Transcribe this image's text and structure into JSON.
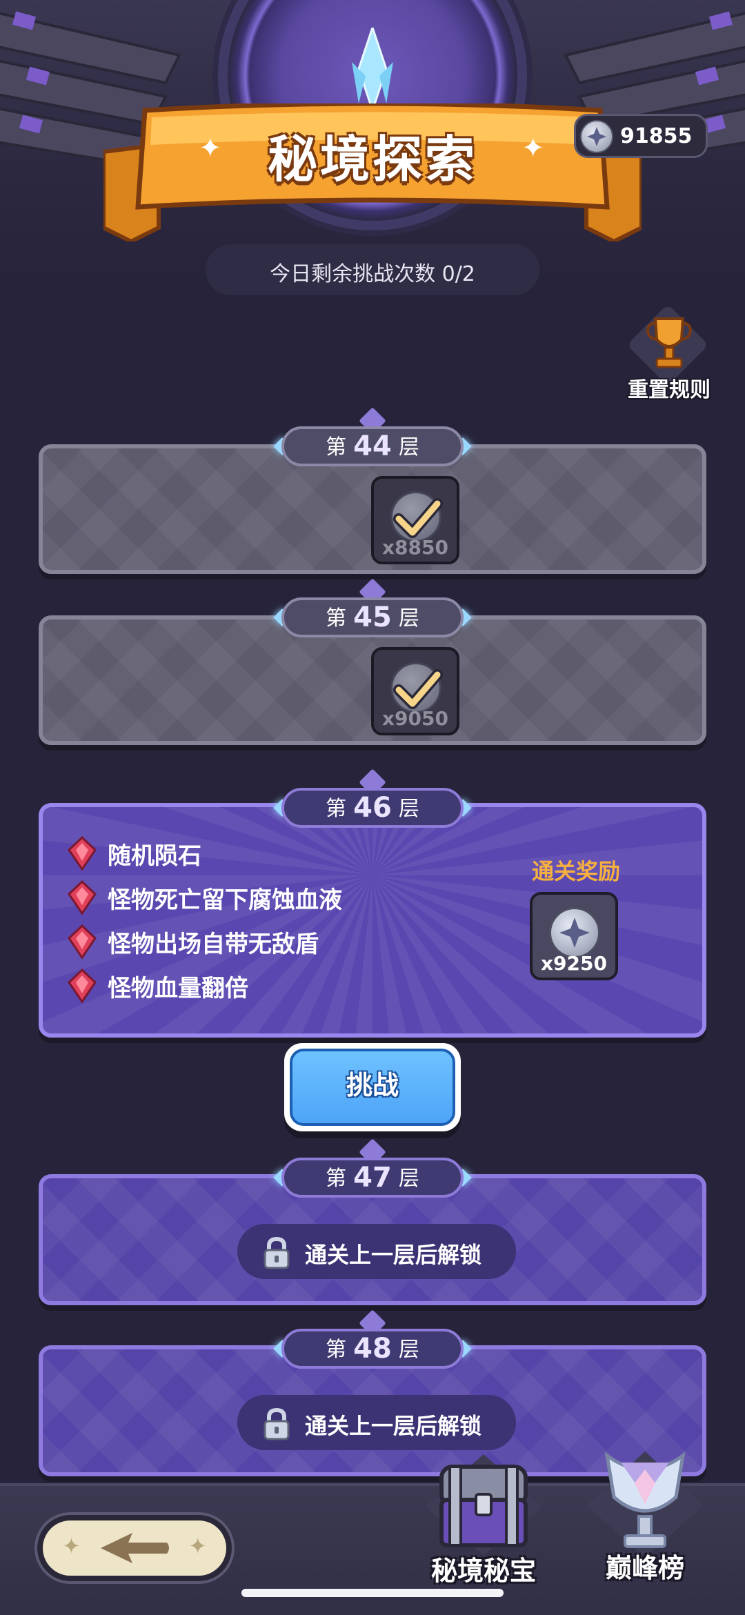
{
  "header": {
    "title": "秘境探索",
    "currency_value": "91855",
    "currency_icon": "silver-star-coin-icon",
    "remaining_attempts": "今日剩余挑战次数 0/2"
  },
  "reset_rules": {
    "label": "重置规则",
    "icon": "trophy-icon"
  },
  "floors": [
    {
      "prefix": "第",
      "number": "44",
      "suffix": "层",
      "state": "completed",
      "reward_qty": "x8850"
    },
    {
      "prefix": "第",
      "number": "45",
      "suffix": "层",
      "state": "completed",
      "reward_qty": "x9050"
    },
    {
      "prefix": "第",
      "number": "46",
      "suffix": "层",
      "state": "current",
      "modifiers": [
        "随机陨石",
        "怪物死亡留下腐蚀血液",
        "怪物出场自带无敌盾",
        "怪物血量翻倍"
      ],
      "reward_title": "通关奖励",
      "reward_qty": "x9250"
    },
    {
      "prefix": "第",
      "number": "47",
      "suffix": "层",
      "state": "locked",
      "lock_text": "通关上一层后解锁"
    },
    {
      "prefix": "第",
      "number": "48",
      "suffix": "层",
      "state": "locked",
      "lock_text": "通关上一层后解锁"
    }
  ],
  "challenge_button": {
    "label": "挑战"
  },
  "bottom_nav": {
    "treasure_label": "秘境秘宝",
    "ranking_label": "巅峰榜"
  },
  "colors": {
    "background": "#26233a",
    "accent_orange": "#f6b040",
    "button_blue": "#4ea4f8",
    "card_purple": "#5a47b0"
  }
}
